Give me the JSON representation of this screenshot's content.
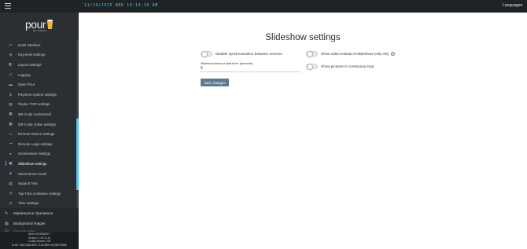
{
  "topbar": {
    "datetime": "11/19/2025 WED   10:14:10 AM",
    "language_label": "Language▾"
  },
  "logo": {
    "brand": "pour",
    "tagline": "MY DRINK"
  },
  "sidebar": {
    "items": [
      {
        "label": "Hotel Interface",
        "icon": "hotel-icon",
        "glyph": "▭"
      },
      {
        "label": "Keg level settings",
        "icon": "keg-icon",
        "glyph": "⊟"
      },
      {
        "label": "Layout settings",
        "icon": "layout-icon",
        "glyph": "◧"
      },
      {
        "label": "Logging",
        "icon": "file-icon",
        "glyph": "▯"
      },
      {
        "label": "Open Pour",
        "icon": "pour-icon",
        "glyph": "▬"
      },
      {
        "label": "Payment system settings",
        "icon": "dollar-icon",
        "glyph": "$"
      },
      {
        "label": "Paytec POP settings",
        "icon": "card-icon",
        "glyph": "▤"
      },
      {
        "label": "QR-Code customized",
        "icon": "qr-icon",
        "glyph": "▦"
      },
      {
        "label": "QR-Code online settings",
        "icon": "qr-icon",
        "glyph": "▦"
      },
      {
        "label": "Remote Device settings",
        "icon": "remote-icon",
        "glyph": "▭"
      },
      {
        "label": "Remote Login settings",
        "icon": "login-icon",
        "glyph": "⇥"
      },
      {
        "label": "Screensaver settings",
        "icon": "screen-icon",
        "glyph": "▸"
      },
      {
        "label": "Slideshow settings",
        "icon": "slideshow-icon",
        "glyph": "▣"
      },
      {
        "label": "Stand-alone-mode",
        "icon": "star-icon",
        "glyph": "★"
      },
      {
        "label": "Support Text",
        "icon": "text-icon",
        "glyph": "▤"
      },
      {
        "label": "Tap Time Limitation settings",
        "icon": "timer-icon",
        "glyph": "◷"
      },
      {
        "label": "Time settings",
        "icon": "clock-icon",
        "glyph": "◷"
      }
    ],
    "active_index": 12,
    "sections": {
      "maintenance": "Maintenance Operations",
      "background": "Background images",
      "partial": "Manage Files"
    }
  },
  "build": {
    "line1": "Build: 20250829FJ",
    "line2": "Version: 1.40.21.10",
    "line3": "Config-Version: 232",
    "line4": "UUID: 0fda7da8-dd91-71e4-89ee-9f128b78f26b"
  },
  "main": {
    "title": "Slideshow settings",
    "sync_label": "Disable synchronization between screens",
    "video_label": "Show video instead of slideshow (only X6)",
    "continuous_label": "Show pictures in continuous loop",
    "timeout_label": "Slideshow timeout start timer (seconds)",
    "timeout_value": "5",
    "save_label": "save changes"
  },
  "colors": {
    "accent": "#4fc3e8",
    "button": "#5c7b93",
    "sidebar_bg": "#2b2f33",
    "topbar_bg": "#1f2326"
  }
}
